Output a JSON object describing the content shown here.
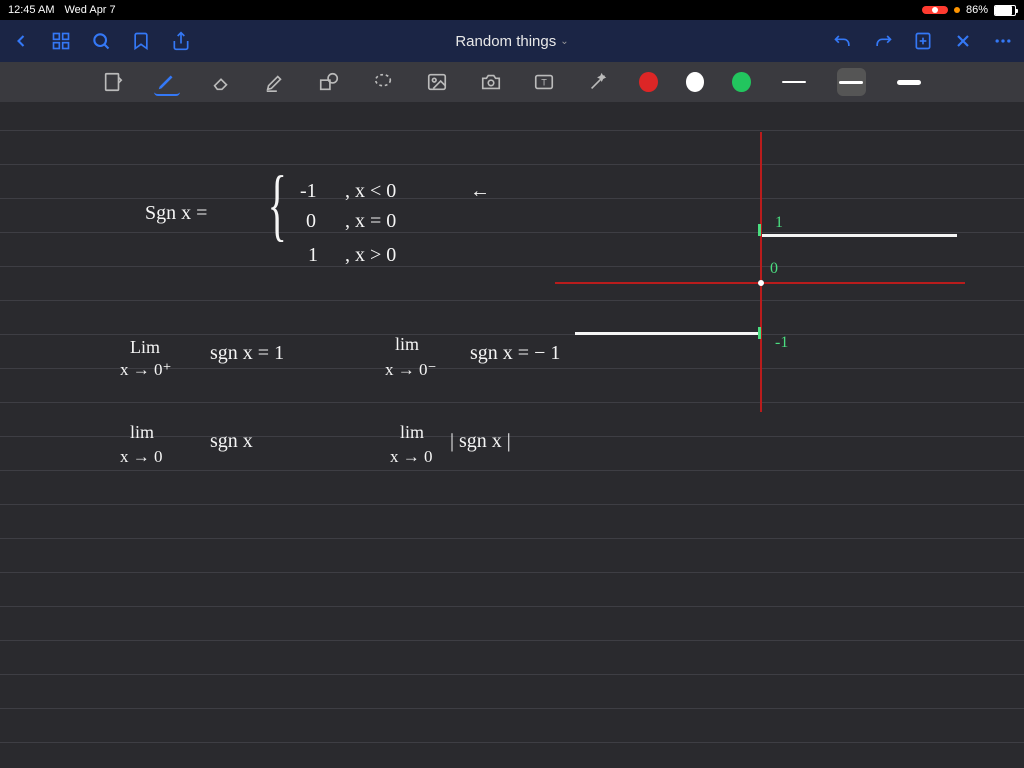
{
  "status": {
    "time": "12:45 AM",
    "date": "Wed Apr 7",
    "battery_pct": "86%"
  },
  "nav": {
    "title": "Random things"
  },
  "tools": {
    "colors": [
      "#dc2626",
      "#ffffff",
      "#22c55e"
    ]
  },
  "notes": {
    "def_lhs": "Sgn  x  =",
    "def_r1a": "-1",
    "def_r1b": ",    x < 0",
    "def_r1c": "←",
    "def_r2a": "0",
    "def_r2b": ",    x = 0",
    "def_r3a": "1",
    "def_r3b": ",    x > 0",
    "lim1_top": "Lim",
    "lim1_bot": "x → 0⁺",
    "lim1_rhs": "sgn x  = 1",
    "lim2_top": "lim",
    "lim2_bot": "x → 0⁻",
    "lim2_rhs": "sgn x  =  − 1",
    "lim3_top": "lim",
    "lim3_bot": "x → 0",
    "lim3_rhs": "sgn  x",
    "lim4_top": "lim",
    "lim4_bot": "x → 0",
    "lim4_rhs": "| sgn x |",
    "label_1": "1",
    "label_0": "0",
    "label_m1": "-1"
  }
}
